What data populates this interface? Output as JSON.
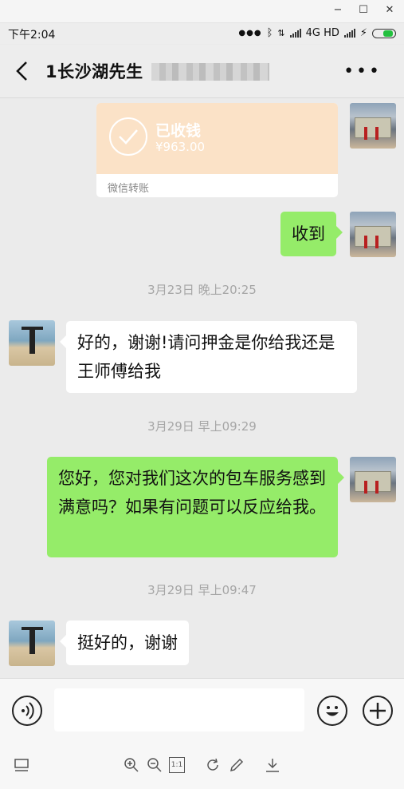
{
  "window": {
    "minimize": "−",
    "maximize": "☐",
    "close": "✕"
  },
  "status_bar": {
    "time": "下午2:04",
    "network": "4G HD"
  },
  "header": {
    "title": "1长沙湖先生",
    "more": "•••"
  },
  "messages": {
    "transfer": {
      "status": "已收钱",
      "amount": "¥963.00",
      "label": "微信转账"
    },
    "m1": "收到",
    "ts1": "3月23日 晚上20:25",
    "m2": "好的，谢谢!请问押金是你给我还是王师傅给我",
    "ts2": "3月29日 早上09:29",
    "m3": "您好，您对我们这次的包车服务感到满意吗？如果有问题可以反应给我。",
    "ts3": "3月29日 早上09:47",
    "m4": "挺好的，谢谢"
  },
  "input": {
    "value": ""
  },
  "toolbar": {
    "fit_label": "1:1"
  },
  "colors": {
    "sent_bubble": "#95ec69",
    "received_bubble": "#ffffff",
    "transfer_card": "#fbe2c7"
  }
}
